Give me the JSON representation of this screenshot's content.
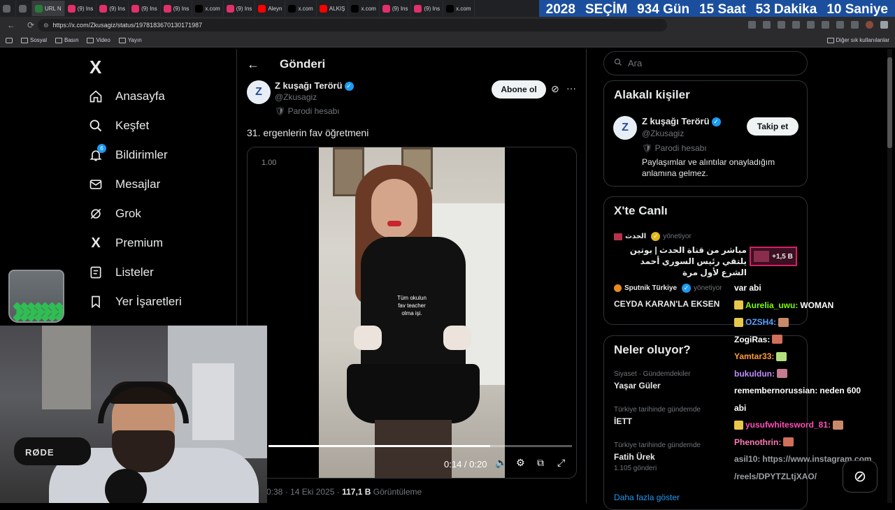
{
  "browser": {
    "tabs": [
      {
        "label": "",
        "color": "#5f6368"
      },
      {
        "label": "",
        "color": "#5f6368"
      },
      {
        "label": "URL N",
        "color": "#2a7a3a",
        "active": true
      },
      {
        "label": "(9) Ins",
        "color": "#e1306c"
      },
      {
        "label": "(9) Ins",
        "color": "#e1306c"
      },
      {
        "label": "(9) Ins",
        "color": "#e1306c"
      },
      {
        "label": "(9) Ins",
        "color": "#e1306c"
      },
      {
        "label": "x.com",
        "color": "#000000"
      },
      {
        "label": "(9) Ins",
        "color": "#e1306c"
      },
      {
        "label": "Aleyn",
        "color": "#ff0000"
      },
      {
        "label": "x.com",
        "color": "#000000"
      },
      {
        "label": "ALKIŞ",
        "color": "#ff0000"
      },
      {
        "label": "x.com",
        "color": "#000000"
      },
      {
        "label": "(9) Ins",
        "color": "#e1306c"
      },
      {
        "label": "(9) Ins",
        "color": "#e1306c"
      },
      {
        "label": "x.com",
        "color": "#000000"
      }
    ],
    "url": "https://x.com/Zkusagiz/status/1978183670130171987",
    "bookmarks": [
      "Sosyal",
      "Basın",
      "Video",
      "Yayın"
    ],
    "bookmarks_other": "Diğer sık kullanılanlar"
  },
  "countdown": {
    "year": "2028",
    "label": "SEÇİM",
    "days": "934 Gün",
    "hours": "15 Saat",
    "minutes": "53 Dakika",
    "seconds": "10 Saniye"
  },
  "nav": {
    "logo": "X",
    "items": [
      {
        "label": "Anasayfa",
        "icon": "home-icon"
      },
      {
        "label": "Keşfet",
        "icon": "search-icon"
      },
      {
        "label": "Bildirimler",
        "icon": "bell-icon",
        "badge": "6"
      },
      {
        "label": "Mesajlar",
        "icon": "mail-icon"
      },
      {
        "label": "Grok",
        "icon": "grok-icon"
      },
      {
        "label": "Premium",
        "icon": "x-icon"
      },
      {
        "label": "Listeler",
        "icon": "list-icon"
      },
      {
        "label": "Yer İşaretleri",
        "icon": "bookmark-icon"
      }
    ]
  },
  "post": {
    "header_title": "Gönderi",
    "author_name": "Z kuşağı Terörü",
    "author_handle": "@Zkusagiz",
    "author_label": "Parodi hesabı",
    "subscribe_label": "Abone ol",
    "text": "31. ergenlerin fav öğretmeni",
    "video": {
      "speed": "1.00",
      "caption": "Tüm okulun\nfav teacher\nolma işi.",
      "time": "0:14 / 0:20",
      "progress": 0.73
    },
    "meta_time": "0:38 · 14 Eki 2025 · ",
    "meta_views": "117,1 B",
    "meta_views_label": " Görüntüleme"
  },
  "right": {
    "search_placeholder": "Ara",
    "related_title": "Alakalı kişiler",
    "related": {
      "name": "Z kuşağı Terörü",
      "handle": "@Zkusagiz",
      "label": "Parodi hesabı",
      "bio": "Paylaşımlar ve alıntılar onayladığım anlamına gelmez.",
      "follow_label": "Takip et"
    },
    "live_title": "X'te Canlı",
    "live": [
      {
        "source": "الحدث",
        "role": "yönetiyor",
        "title": "مباشر من قناة الحدث | بوتين يلتقي رئيس السوري أحمد الشرع لأول مرة",
        "badge": "+1,5 B"
      },
      {
        "source": "Sputnik Türkiye",
        "role": "yönetiyor",
        "title": "CEYDA KARAN'LA EKSEN"
      }
    ],
    "trends_title": "Neler oluyor?",
    "trends": [
      {
        "category": "Siyaset · Gündemdekiler",
        "name": "Yaşar Güler",
        "count": ""
      },
      {
        "category": "Türkiye tarihinde gündemde",
        "name": "İETT",
        "count": ""
      },
      {
        "category": "Türkiye tarihinde gündemde",
        "name": "Fatih Ürek",
        "count": "1.105 gönderi"
      }
    ],
    "show_more": "Daha fazla göster"
  },
  "stream": {
    "mic_brand": "RØDE",
    "chat": [
      {
        "user": "",
        "text": "var abi",
        "color": "#ffffff"
      },
      {
        "user": "Aurelia_uwu",
        "text": "WOMAN",
        "color": "#7cfc00"
      },
      {
        "user": "OZSH4",
        "text": "",
        "color": "#5aa0ff"
      },
      {
        "user": "ZogiRas",
        "text": "",
        "color": "#ffffff"
      },
      {
        "user": "Yamtar33",
        "text": "",
        "color": "#ff9b3d"
      },
      {
        "user": "bukuldun",
        "text": "",
        "color": "#c08cff"
      },
      {
        "user": "remembernorussian",
        "text": "neden 600",
        "color": "#ffffff"
      },
      {
        "user": "",
        "text": "abi",
        "color": "#ffffff"
      },
      {
        "user": "yusufwhitesword_81",
        "text": "",
        "color": "#ff4fb8"
      },
      {
        "user": "Phenothrin",
        "text": "",
        "color": "#ff7ab8"
      },
      {
        "user": "asil10",
        "text": "https://www.instagram.com",
        "color": "#9aa0a6"
      },
      {
        "user": "",
        "text": "/reels/DPYTZLtjXAO/",
        "color": "#9aa0a6"
      }
    ]
  },
  "colors": {
    "accent": "#1d9bf0",
    "countdown_bg": "#1b4f9e",
    "live_badge": "#d61f69"
  }
}
